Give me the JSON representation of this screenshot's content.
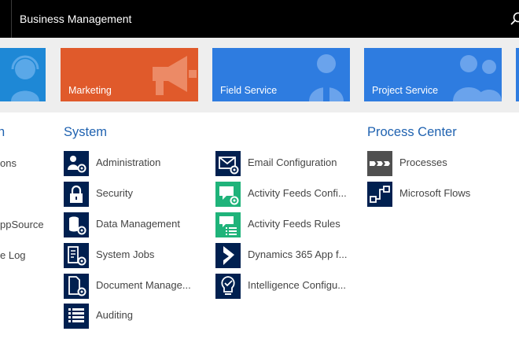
{
  "header": {
    "title": "Business Management"
  },
  "tiles": [
    {
      "label": "",
      "color": "#1e88d6",
      "icon": "headset-person-icon"
    },
    {
      "label": "Marketing",
      "color": "#e05a2b",
      "icon": "megaphone-icon"
    },
    {
      "label": "Field Service",
      "color": "#2e7ce0",
      "icon": "field-technician-icon"
    },
    {
      "label": "Project Service",
      "color": "#2e7ce0",
      "icon": "people-icon"
    }
  ],
  "left_column": {
    "title": "n",
    "items": [
      "ons",
      "ppSource",
      "e Log"
    ]
  },
  "system": {
    "title": "System",
    "col1": [
      {
        "label": "Administration",
        "icon": "users-gear-icon",
        "color": "#002050"
      },
      {
        "label": "Security",
        "icon": "lock-icon",
        "color": "#002050"
      },
      {
        "label": "Data Management",
        "icon": "database-gear-icon",
        "color": "#002050"
      },
      {
        "label": "System Jobs",
        "icon": "jobs-gear-icon",
        "color": "#002050"
      },
      {
        "label": "Document Manage...",
        "icon": "document-gear-icon",
        "color": "#002050"
      },
      {
        "label": "Auditing",
        "icon": "list-icon",
        "color": "#002050"
      }
    ],
    "col2": [
      {
        "label": "Email Configuration",
        "icon": "email-gear-icon",
        "color": "#002050"
      },
      {
        "label": "Activity Feeds Confi...",
        "icon": "activity-feed-gear-icon",
        "color": "#1fb37a"
      },
      {
        "label": "Activity Feeds Rules",
        "icon": "activity-feed-list-icon",
        "color": "#1fb37a"
      },
      {
        "label": "Dynamics 365 App f...",
        "icon": "dynamics-365-icon",
        "color": "#002050"
      },
      {
        "label": "Intelligence Configu...",
        "icon": "lightbulb-check-icon",
        "color": "#002050"
      }
    ]
  },
  "process_center": {
    "title": "Process Center",
    "items": [
      {
        "label": "Processes",
        "icon": "process-arrows-icon",
        "color": "#505050"
      },
      {
        "label": "Microsoft Flows",
        "icon": "flow-icon",
        "color": "#002050"
      }
    ]
  }
}
